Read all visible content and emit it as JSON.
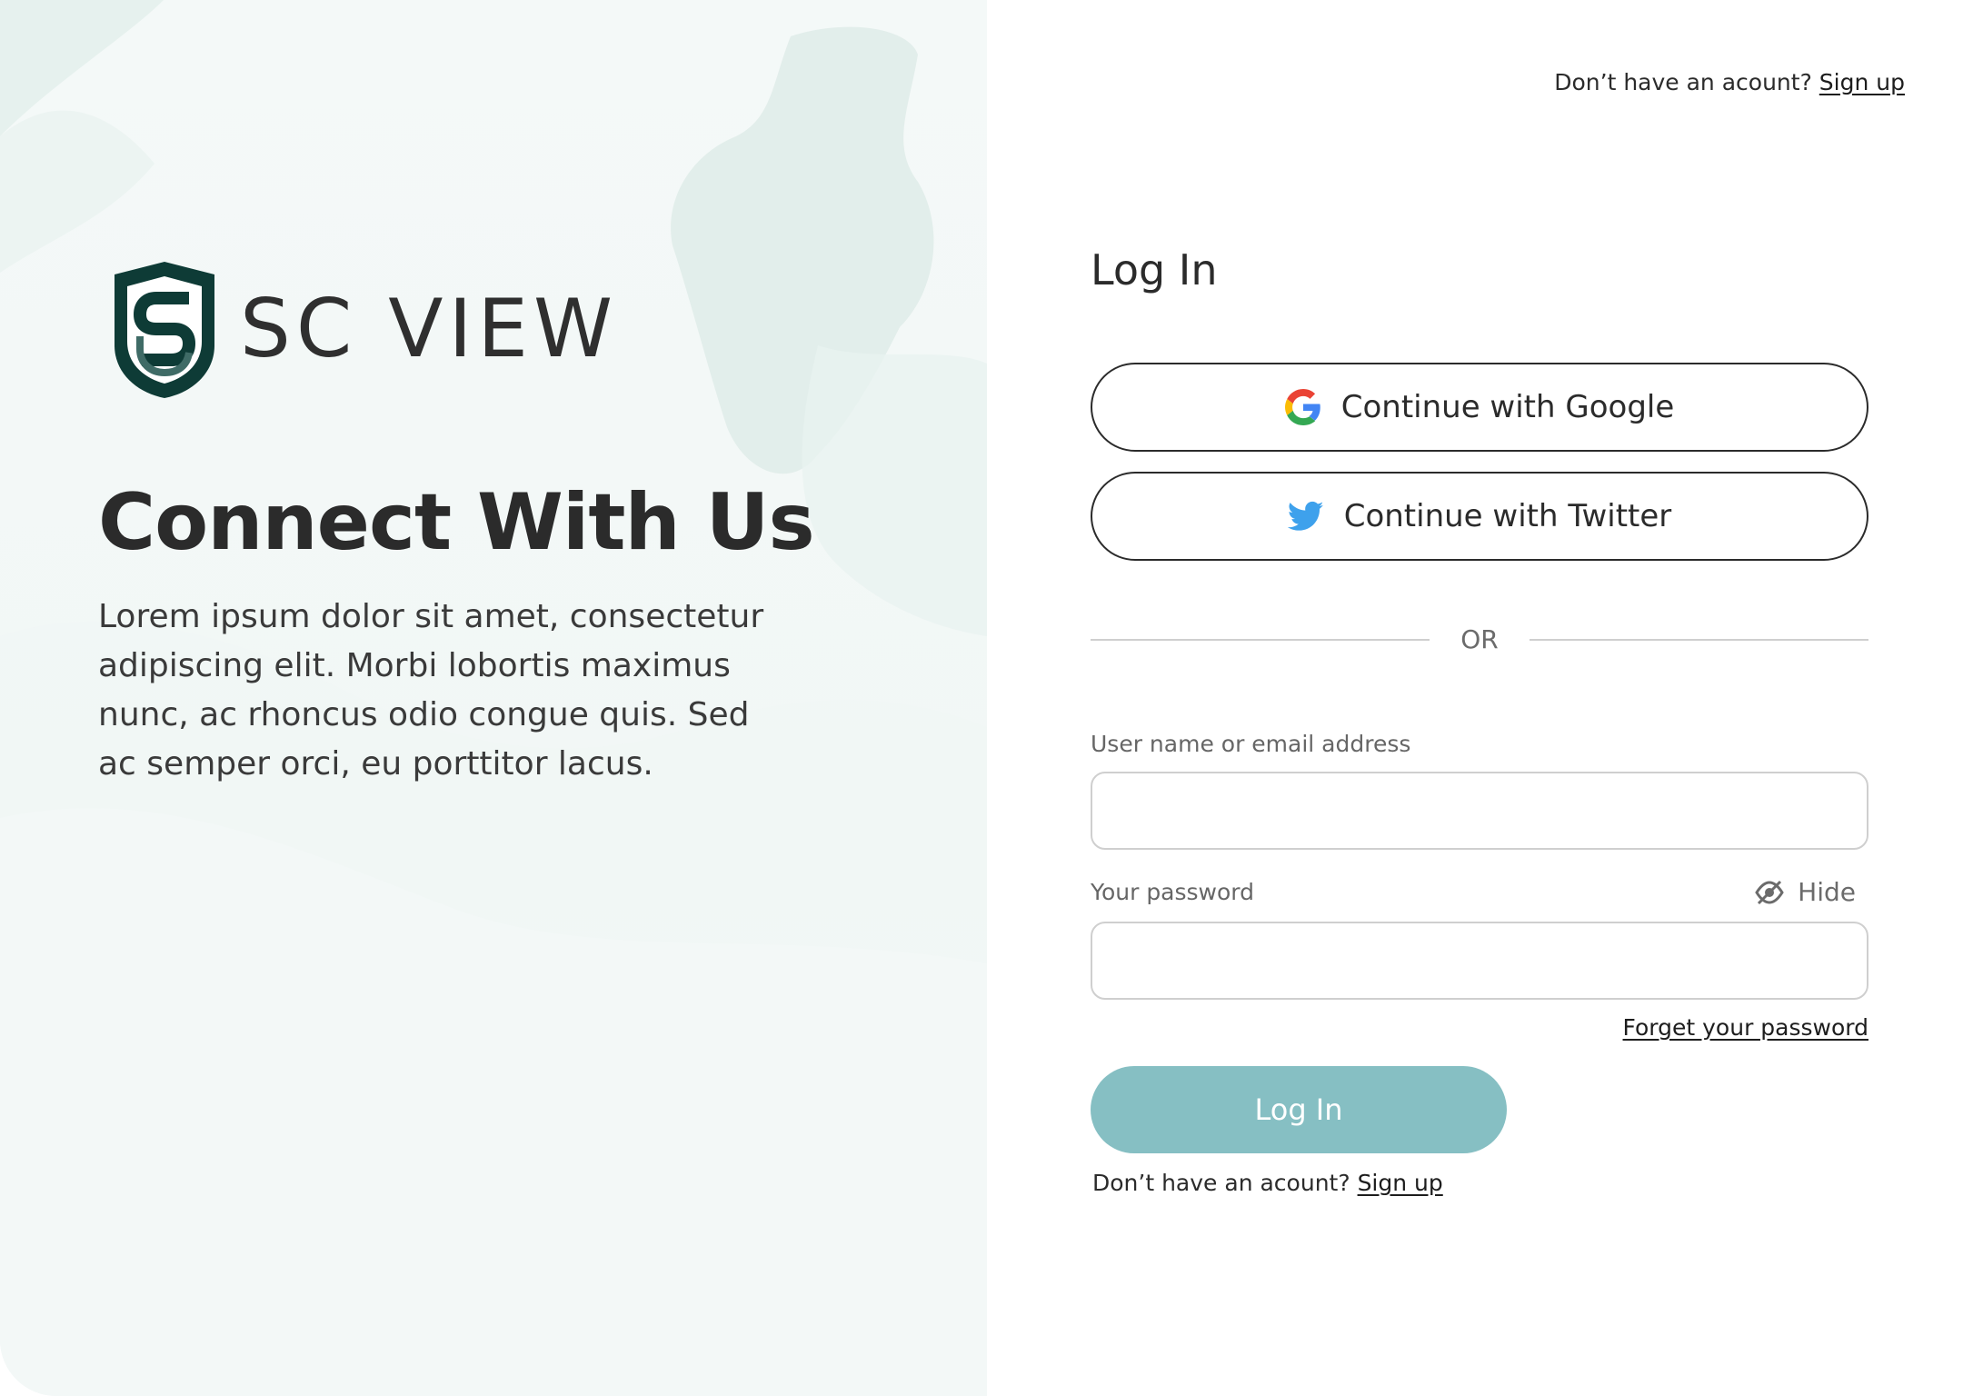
{
  "header": {
    "signup_prompt": "Don’t have an acount?",
    "signup_link": "Sign up"
  },
  "brand": {
    "name": "SC VIEW",
    "logo_icon": "shield-logo-icon",
    "primary_color": "#0e3b36"
  },
  "hero": {
    "title": "Connect With Us",
    "description": "Lorem ipsum dolor sit amet, consectetur adipiscing elit. Morbi lobortis maximus nunc, ac rhoncus odio congue quis. Sed ac semper orci, eu porttitor lacus."
  },
  "form": {
    "title": "Log In",
    "google_label": "Continue with Google",
    "twitter_label": "Continue with Twitter",
    "google_icon": "google-icon",
    "twitter_icon": "twitter-icon",
    "divider_text": "OR",
    "username_label": "User name or email address",
    "username_value": "",
    "password_label": "Your password",
    "password_value": "",
    "hide_label": "Hide",
    "hide_icon": "eye-slash-icon",
    "forgot_link": "Forget your password",
    "login_button": "Log In",
    "login_button_color": "#86bfc3",
    "bottom_signup_prompt": "Don’t have an acount?",
    "bottom_signup_link": "Sign up"
  }
}
